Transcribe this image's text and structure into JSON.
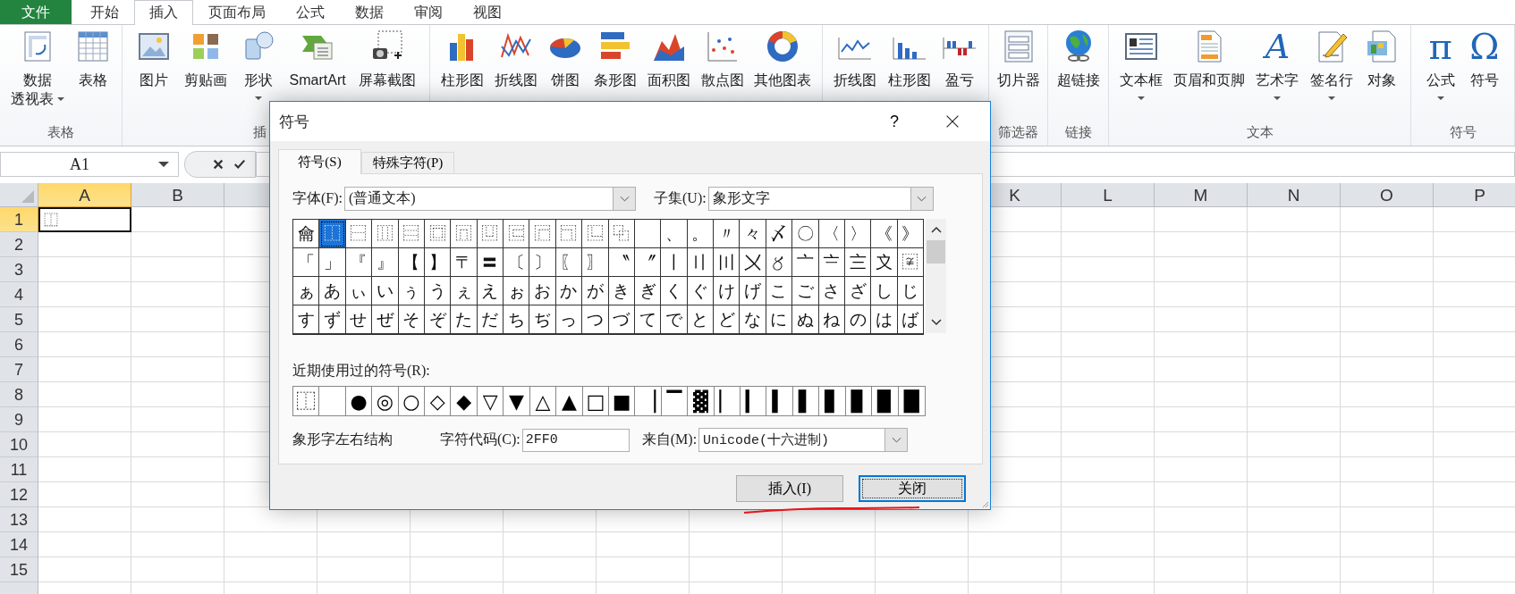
{
  "menu_tabs": [
    {
      "label": "文件",
      "kind": "file",
      "selected": false
    },
    {
      "label": "开始",
      "kind": "tab",
      "selected": false
    },
    {
      "label": "插入",
      "kind": "tab",
      "selected": true
    },
    {
      "label": "页面布局",
      "kind": "tab",
      "selected": false
    },
    {
      "label": "公式",
      "kind": "tab",
      "selected": false
    },
    {
      "label": "数据",
      "kind": "tab",
      "selected": false
    },
    {
      "label": "审阅",
      "kind": "tab",
      "selected": false
    },
    {
      "label": "视图",
      "kind": "tab",
      "selected": false
    }
  ],
  "ribbon": {
    "groups": [
      {
        "label": "表格",
        "items": [
          {
            "label": "数据",
            "label_2": "透视表",
            "dropdown": true
          },
          {
            "label": "表格"
          }
        ]
      },
      {
        "label": "插",
        "items": [
          {
            "label": "图片"
          },
          {
            "label": "剪贴画"
          },
          {
            "label": "形状",
            "dropdown": true
          },
          {
            "label": "SmartArt"
          },
          {
            "label": "屏幕截图"
          }
        ]
      },
      {
        "items": [
          {
            "label": "柱形图"
          },
          {
            "label": "折线图"
          },
          {
            "label": "饼图"
          },
          {
            "label": "条形图"
          },
          {
            "label": "面积图"
          },
          {
            "label": "散点图"
          },
          {
            "label": "其他图表"
          }
        ]
      },
      {
        "items": [
          {
            "label": "折线图"
          },
          {
            "label": "柱形图"
          },
          {
            "label": "盈亏"
          }
        ]
      },
      {
        "label": "筛选器",
        "items": [
          {
            "label": "切片器"
          }
        ]
      },
      {
        "label": "链接",
        "items": [
          {
            "label": "超链接"
          }
        ]
      },
      {
        "label": "文本",
        "items": [
          {
            "label": "文本框",
            "dropdown": true
          },
          {
            "label": "页眉和页脚"
          },
          {
            "label": "艺术字",
            "glyph": "A",
            "dropdown": true
          },
          {
            "label": "签名行",
            "dropdown": true
          },
          {
            "label": "对象"
          }
        ]
      },
      {
        "label": "符号",
        "items": [
          {
            "label": "公式",
            "glyph": "π",
            "dropdown": true
          },
          {
            "label": "符号",
            "glyph": "Ω"
          }
        ]
      }
    ]
  },
  "formula_bar": {
    "name_box": "A1"
  },
  "sheet": {
    "columns": [
      {
        "label": "A",
        "selected": true
      },
      {
        "label": "B",
        "selected": false
      },
      {
        "label": "K",
        "selected": false
      },
      {
        "label": "L",
        "selected": false
      },
      {
        "label": "M",
        "selected": false
      },
      {
        "label": "N",
        "selected": false
      },
      {
        "label": "O",
        "selected": false
      },
      {
        "label": "P",
        "selected": false
      }
    ],
    "rows": [
      {
        "label": "1",
        "selected": true,
        "cells": [
          "⿰"
        ]
      },
      {
        "label": "2",
        "selected": false
      },
      {
        "label": "3",
        "selected": false
      },
      {
        "label": "4",
        "selected": false
      },
      {
        "label": "5",
        "selected": false
      },
      {
        "label": "6",
        "selected": false
      },
      {
        "label": "7",
        "selected": false
      },
      {
        "label": "8",
        "selected": false
      },
      {
        "label": "9",
        "selected": false
      },
      {
        "label": "10",
        "selected": false
      },
      {
        "label": "11",
        "selected": false
      },
      {
        "label": "12",
        "selected": false
      },
      {
        "label": "13",
        "selected": false
      },
      {
        "label": "14",
        "selected": false
      },
      {
        "label": "15",
        "selected": false
      }
    ]
  },
  "dialog": {
    "title": "符号",
    "help": "?",
    "tabs": [
      {
        "label": "符号(S)",
        "selected": true
      },
      {
        "label": "特殊字符(P)",
        "selected": false
      }
    ],
    "font_label": "字体(F):",
    "font_value": "(普通文本)",
    "subset_label": "子集(U):",
    "subset_value": "象形文字",
    "grid": [
      [
        {
          "char": "⿕",
          "selected": false
        },
        {
          "char": "⿰",
          "selected": true
        },
        {
          "char": "⿱",
          "selected": false
        },
        {
          "char": "⿲",
          "selected": false
        },
        {
          "char": "⿳",
          "selected": false
        },
        {
          "char": "⿴",
          "selected": false
        },
        {
          "char": "⿵",
          "selected": false
        },
        {
          "char": "⿶",
          "selected": false
        },
        {
          "char": "⿷",
          "selected": false
        },
        {
          "char": "⿸",
          "selected": false
        },
        {
          "char": "⿹",
          "selected": false
        },
        {
          "char": "⿺",
          "selected": false
        },
        {
          "char": "⿻",
          "selected": false
        },
        {
          "selected": false
        },
        {
          "char": "、",
          "selected": false
        },
        {
          "char": "。",
          "selected": false
        },
        {
          "char": "〃",
          "selected": false
        },
        {
          "char": "々",
          "selected": false
        },
        {
          "char": "〆",
          "selected": false
        },
        {
          "char": "〇",
          "selected": false
        },
        {
          "char": "〈",
          "selected": false
        },
        {
          "char": "〉",
          "selected": false
        },
        {
          "char": "《",
          "selected": false
        },
        {
          "char": "》",
          "selected": false
        }
      ],
      [
        {
          "char": "「",
          "selected": false
        },
        {
          "char": "」",
          "selected": false
        },
        {
          "char": "『",
          "selected": false
        },
        {
          "char": "』",
          "selected": false
        },
        {
          "char": "【",
          "selected": false
        },
        {
          "char": "】",
          "selected": false
        },
        {
          "char": "〒",
          "selected": false
        },
        {
          "char": "〓",
          "selected": false
        },
        {
          "char": "〔",
          "selected": false
        },
        {
          "char": "〕",
          "selected": false
        },
        {
          "char": "〖",
          "selected": false
        },
        {
          "char": "〗",
          "selected": false
        },
        {
          "char": "〝",
          "selected": false
        },
        {
          "char": "〞",
          "selected": false
        },
        {
          "char": "〡",
          "selected": false
        },
        {
          "char": "〢",
          "selected": false
        },
        {
          "char": "〣",
          "selected": false
        },
        {
          "char": "〤",
          "selected": false
        },
        {
          "char": "〥",
          "selected": false
        },
        {
          "char": "〦",
          "selected": false
        },
        {
          "char": "〧",
          "selected": false
        },
        {
          "char": "〨",
          "selected": false
        },
        {
          "char": "〩",
          "selected": false
        },
        {
          "char": "〾",
          "selected": false
        }
      ],
      [
        {
          "char": "ぁ",
          "selected": false
        },
        {
          "char": "あ",
          "selected": false
        },
        {
          "char": "ぃ",
          "selected": false
        },
        {
          "char": "い",
          "selected": false
        },
        {
          "char": "ぅ",
          "selected": false
        },
        {
          "char": "う",
          "selected": false
        },
        {
          "char": "ぇ",
          "selected": false
        },
        {
          "char": "え",
          "selected": false
        },
        {
          "char": "ぉ",
          "selected": false
        },
        {
          "char": "お",
          "selected": false
        },
        {
          "char": "か",
          "selected": false
        },
        {
          "char": "が",
          "selected": false
        },
        {
          "char": "き",
          "selected": false
        },
        {
          "char": "ぎ",
          "selected": false
        },
        {
          "char": "く",
          "selected": false
        },
        {
          "char": "ぐ",
          "selected": false
        },
        {
          "char": "け",
          "selected": false
        },
        {
          "char": "げ",
          "selected": false
        },
        {
          "char": "こ",
          "selected": false
        },
        {
          "char": "ご",
          "selected": false
        },
        {
          "char": "さ",
          "selected": false
        },
        {
          "char": "ざ",
          "selected": false
        },
        {
          "char": "し",
          "selected": false
        },
        {
          "char": "じ",
          "selected": false
        }
      ],
      [
        {
          "char": "す",
          "selected": false
        },
        {
          "char": "ず",
          "selected": false
        },
        {
          "char": "せ",
          "selected": false
        },
        {
          "char": "ぜ",
          "selected": false
        },
        {
          "char": "そ",
          "selected": false
        },
        {
          "char": "ぞ",
          "selected": false
        },
        {
          "char": "た",
          "selected": false
        },
        {
          "char": "だ",
          "selected": false
        },
        {
          "char": "ち",
          "selected": false
        },
        {
          "char": "ぢ",
          "selected": false
        },
        {
          "char": "っ",
          "selected": false
        },
        {
          "char": "つ",
          "selected": false
        },
        {
          "char": "づ",
          "selected": false
        },
        {
          "char": "て",
          "selected": false
        },
        {
          "char": "で",
          "selected": false
        },
        {
          "char": "と",
          "selected": false
        },
        {
          "char": "ど",
          "selected": false
        },
        {
          "char": "な",
          "selected": false
        },
        {
          "char": "に",
          "selected": false
        },
        {
          "char": "ぬ",
          "selected": false
        },
        {
          "char": "ね",
          "selected": false
        },
        {
          "char": "の",
          "selected": false
        },
        {
          "char": "は",
          "selected": false
        },
        {
          "char": "ば",
          "selected": false
        }
      ]
    ],
    "recent_label": "近期使用过的符号(R):",
    "recent": [
      {
        "kind": "symbol",
        "char": "⿰"
      },
      {
        "kind": "blank"
      },
      {
        "kind": "symbol",
        "char": "●"
      },
      {
        "kind": "symbol",
        "char": "◎"
      },
      {
        "kind": "symbol",
        "char": "○"
      },
      {
        "kind": "symbol",
        "char": "◇"
      },
      {
        "kind": "symbol",
        "char": "◆"
      },
      {
        "kind": "symbol",
        "char": "▽"
      },
      {
        "kind": "symbol",
        "char": "▼"
      },
      {
        "kind": "symbol",
        "char": "△"
      },
      {
        "kind": "symbol",
        "char": "▲"
      },
      {
        "kind": "symbol",
        "char": "□"
      },
      {
        "kind": "symbol",
        "char": "■"
      },
      {
        "kind": "symbol",
        "char": "▕"
      },
      {
        "kind": "symbol",
        "char": "▔"
      },
      {
        "kind": "symbol",
        "char": "▓"
      },
      {
        "kind": "symbol",
        "char": "▏"
      },
      {
        "kind": "symbol",
        "char": "▎"
      },
      {
        "kind": "symbol",
        "char": "▍"
      },
      {
        "kind": "symbol",
        "char": "▌"
      },
      {
        "kind": "symbol",
        "char": "▋"
      },
      {
        "kind": "symbol",
        "char": "▊"
      },
      {
        "kind": "symbol",
        "char": "▉"
      },
      {
        "kind": "symbol",
        "char": "█"
      }
    ],
    "char_name": "象形字左右结构",
    "code_label": "字符代码(C):",
    "code_value": "2FF0",
    "from_label": "来自(M):",
    "from_value": "Unicode(十六进制)",
    "buttons": [
      {
        "label": "插入(I)",
        "default": false
      },
      {
        "label": "关闭",
        "default": true
      }
    ]
  }
}
